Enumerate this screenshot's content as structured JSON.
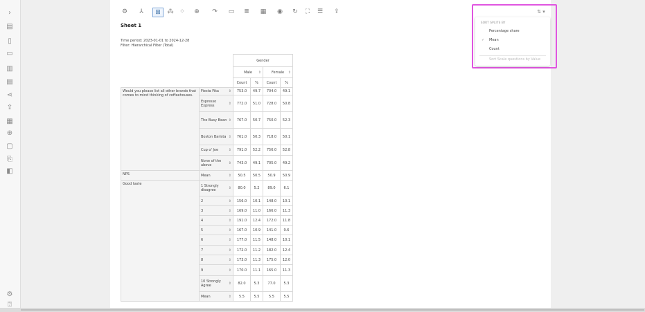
{
  "rail": {
    "icons": [
      "chevron-right-icon",
      "report-icon",
      "page-icon",
      "folder-icon",
      "data-icon",
      "note-icon",
      "share-icon",
      "export-icon",
      "chart-icon",
      "add-icon",
      "frame-icon",
      "copy-icon",
      "layers-icon",
      "settings-icon",
      "help-icon"
    ]
  },
  "toolbar": {
    "buttons": [
      {
        "name": "filter-icon",
        "glyph": "⚙"
      },
      {
        "name": "split-icon",
        "glyph": "⅄"
      },
      {
        "name": "table-icon",
        "glyph": "⊞",
        "active": true
      },
      {
        "name": "significance-icon",
        "glyph": "⁂"
      },
      {
        "name": "decimal-icon",
        "glyph": "⁘"
      },
      {
        "name": "weight-icon",
        "glyph": "⊕"
      },
      {
        "name": "redo-icon",
        "glyph": "↷"
      },
      {
        "name": "comment-icon",
        "glyph": "▭"
      },
      {
        "name": "format-icon",
        "glyph": "≣"
      },
      {
        "name": "layout-icon",
        "glyph": "▦"
      },
      {
        "name": "visibility-icon",
        "glyph": "◉"
      },
      {
        "name": "refresh-icon",
        "glyph": "↻"
      },
      {
        "name": "fullscreen-icon",
        "glyph": "⛶"
      },
      {
        "name": "columns-icon",
        "glyph": "☰"
      },
      {
        "name": "export-icon",
        "glyph": "⇪"
      }
    ]
  },
  "sheet": {
    "title": "Sheet 1",
    "time_period": "Time period: 2023-01-01 to 2024-12-28",
    "filter": "Filter: Hierarchical Filter (Total)"
  },
  "table": {
    "group_header": "Gender",
    "columns": [
      "Male",
      "Female"
    ],
    "subcolumns": [
      "Count",
      "%",
      "Count",
      "%"
    ],
    "sections": [
      {
        "label": "Would you please list all other brands that comes to mind thinking of coffeehouses.",
        "rows": [
          {
            "cat": "Fiesta Fika",
            "vals": [
              "753.0",
              "49.7",
              "704.0",
              "49.1"
            ]
          },
          {
            "cat": "Espresso Express",
            "vals": [
              "772.0",
              "51.0",
              "728.0",
              "50.8"
            ]
          },
          {
            "cat": "The Busy Bean",
            "vals": [
              "767.0",
              "50.7",
              "750.0",
              "52.3"
            ]
          },
          {
            "cat": "Boston Barista",
            "vals": [
              "761.0",
              "50.3",
              "718.0",
              "50.1"
            ]
          },
          {
            "cat": "Cup o' Joe",
            "vals": [
              "791.0",
              "52.2",
              "756.0",
              "52.8"
            ]
          },
          {
            "cat": "None of the above",
            "vals": [
              "743.0",
              "49.1",
              "705.0",
              "49.2"
            ]
          }
        ]
      },
      {
        "label": "NPS",
        "rows": [
          {
            "cat": "Mean",
            "vals": [
              "50.5",
              "50.5",
              "50.9",
              "50.9"
            ]
          }
        ]
      },
      {
        "label": "Good taste",
        "rows": [
          {
            "cat": "1 Strongly disagree",
            "vals": [
              "80.0",
              "5.2",
              "89.0",
              "6.1"
            ]
          },
          {
            "cat": "2",
            "vals": [
              "156.0",
              "10.1",
              "148.0",
              "10.1"
            ]
          },
          {
            "cat": "3",
            "vals": [
              "169.0",
              "11.0",
              "166.0",
              "11.3"
            ]
          },
          {
            "cat": "4",
            "vals": [
              "191.0",
              "12.4",
              "172.0",
              "11.8"
            ]
          },
          {
            "cat": "5",
            "vals": [
              "167.0",
              "10.9",
              "141.0",
              "9.6"
            ]
          },
          {
            "cat": "6",
            "vals": [
              "177.0",
              "11.5",
              "148.0",
              "10.1"
            ]
          },
          {
            "cat": "7",
            "vals": [
              "172.0",
              "11.2",
              "182.0",
              "12.4"
            ]
          },
          {
            "cat": "8",
            "vals": [
              "173.0",
              "11.3",
              "175.0",
              "12.0"
            ]
          },
          {
            "cat": "9",
            "vals": [
              "170.0",
              "11.1",
              "165.0",
              "11.3"
            ]
          },
          {
            "cat": "10 Strongly Agree",
            "vals": [
              "82.0",
              "5.3",
              "77.0",
              "5.3"
            ]
          },
          {
            "cat": "Mean",
            "vals": [
              "5.5",
              "5.5",
              "5.5",
              "5.5"
            ]
          }
        ]
      }
    ]
  },
  "sort_menu": {
    "button_glyph": "⇅ ▾",
    "heading": "SORT SPLITS BY",
    "items": [
      {
        "label": "Percentage share",
        "checked": false,
        "disabled": false
      },
      {
        "label": "Mean",
        "checked": true,
        "disabled": false
      },
      {
        "label": "Count",
        "checked": false,
        "disabled": false
      }
    ],
    "scale_option": "Sort Scale questions by Value",
    "check_glyph": "✓"
  },
  "sort_glyph": "⇕",
  "dropdown_glyph": "▾"
}
